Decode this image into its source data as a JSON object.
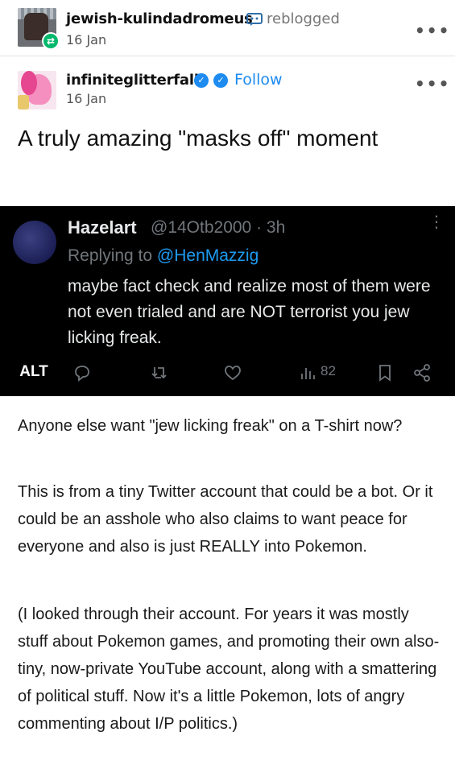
{
  "reblog_header": {
    "username": "jewish-kulindadromeus",
    "action": "reblogged",
    "date": "16 Jan",
    "reblog_icon": "reblog-icon",
    "more_icon": "more-horizontal-icon"
  },
  "post_header": {
    "username": "infiniteglitterfall",
    "follow_label": "Follow",
    "date": "16 Jan",
    "verified_icon": "verified-check-icon",
    "more_icon": "more-horizontal-icon"
  },
  "post": {
    "title": "A truly amazing \"masks off\" moment",
    "paragraphs": [
      "Anyone else want \"jew licking freak\" on a T-shirt now?",
      "This is from a tiny Twitter account that could be a bot. Or it could be an asshole who also claims to want peace for everyone and also is just REALLY into Pokemon.",
      "(I looked through their account. For years it was mostly stuff about Pokemon games, and promoting their own also-tiny, now-private YouTube account, along with a smattering of political stuff. Now it's a little Pokemon, lots of angry commenting about I/P politics.)"
    ]
  },
  "tweet": {
    "name": "Hazelart",
    "handle": "@14Otb2000 · 3h",
    "replying_prefix": "Replying to ",
    "replying_to": "@HenMazzig",
    "body": "maybe fact check and realize most of them were not even trialed and are NOT terrorist you jew licking freak.",
    "alt_label": "ALT",
    "views": "82",
    "icons": [
      "reply-icon",
      "retweet-icon",
      "like-icon",
      "views-icon",
      "bookmark-icon",
      "share-icon"
    ]
  },
  "colors": {
    "accent": "#1d8bf0",
    "reblog_green": "#00b86b",
    "tweet_bg": "#000000",
    "tweet_muted": "#71767b",
    "tweet_link": "#1d9bf0"
  }
}
